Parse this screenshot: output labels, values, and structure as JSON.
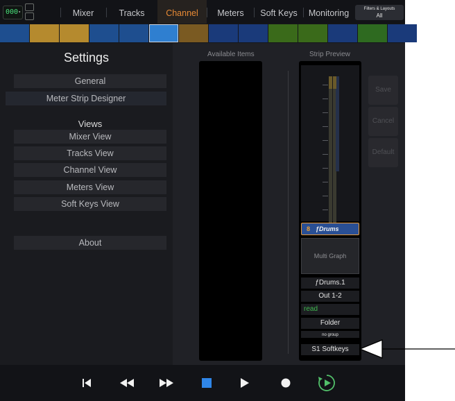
{
  "topbar": {
    "counter": "000",
    "tabs": [
      "Mixer",
      "Tracks",
      "Channel",
      "Meters",
      "Soft Keys",
      "Monitoring"
    ],
    "active_tab": "Channel",
    "filters": {
      "label": "Filters & Layouts",
      "value": "All"
    }
  },
  "strip_colors": [
    "#1e4e8f",
    "#b58a2e",
    "#b58a2e",
    "#1e4e8f",
    "#1e4e8f",
    "#2f7fd0",
    "#7a5a22",
    "#1a3a7a",
    "#1a3a7a",
    "#3a6a1a",
    "#3a6a1a",
    "#1a3a7a",
    "#2e6a20",
    "#1a3a7a"
  ],
  "settings": {
    "title": "Settings",
    "general": "General",
    "meter_strip_designer": "Meter Strip Designer",
    "views_heading": "Views",
    "views": [
      "Mixer View",
      "Tracks View",
      "Channel View",
      "Meters View",
      "Soft Keys View"
    ],
    "about": "About"
  },
  "available_items": {
    "header": "Available Items"
  },
  "strip_preview": {
    "header": "Strip Preview",
    "track_number": "8",
    "track_name": "ƒDrums",
    "multi_graph": "Multi Graph",
    "fields": [
      "ƒDrums.1",
      "Out 1-2",
      "read",
      "Folder"
    ],
    "group": "no group",
    "softkeys": "S1 Softkeys"
  },
  "side_buttons": {
    "save": "Save",
    "cancel": "Cancel",
    "default": "Default"
  },
  "transport": {
    "icons": [
      "go-to-start-icon",
      "rewind-icon",
      "fast-forward-icon",
      "stop-icon",
      "play-icon",
      "record-icon",
      "loop-playback-icon"
    ]
  },
  "colors": {
    "accent": "#e88a35",
    "read_green": "#3fb950",
    "panel_bg": "#1a1b1f",
    "selection_blue": "#2a4f94"
  }
}
